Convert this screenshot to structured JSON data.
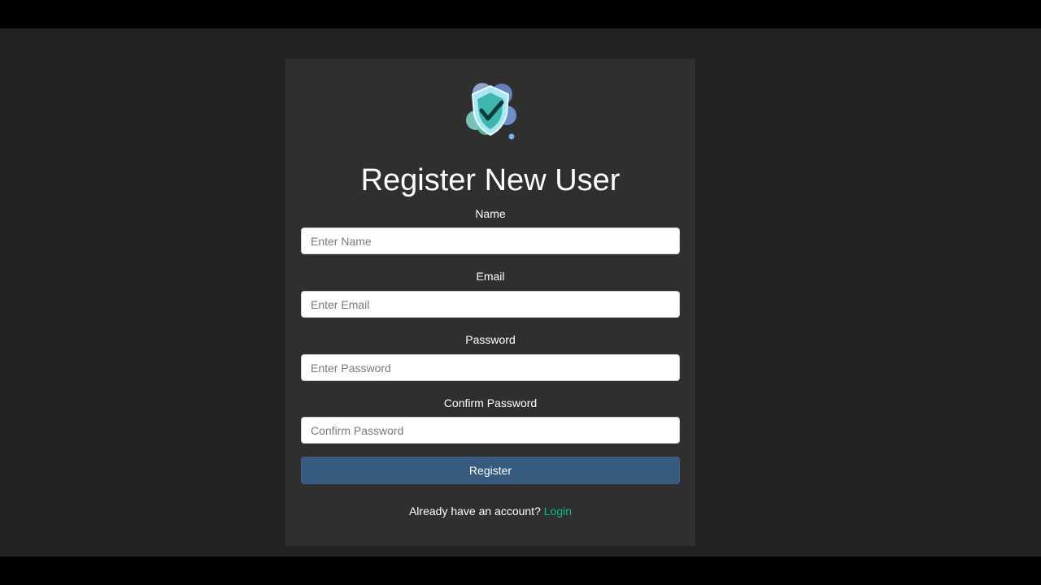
{
  "form": {
    "title": "Register New User",
    "fields": [
      {
        "label": "Name",
        "placeholder": "Enter Name",
        "value": ""
      },
      {
        "label": "Email",
        "placeholder": "Enter Email",
        "value": ""
      },
      {
        "label": "Password",
        "placeholder": "Enter Password",
        "value": ""
      },
      {
        "label": "Confirm Password",
        "placeholder": "Confirm Password",
        "value": ""
      }
    ],
    "submit_label": "Register",
    "footer_text": "Already have an account?",
    "login_link_label": "Login"
  },
  "logo": {
    "icon": "shield-check-icon"
  },
  "colors": {
    "page_background": "#222222",
    "card_background": "#2f2f2f",
    "primary_button": "#375a7f",
    "link": "#00bc8c"
  }
}
